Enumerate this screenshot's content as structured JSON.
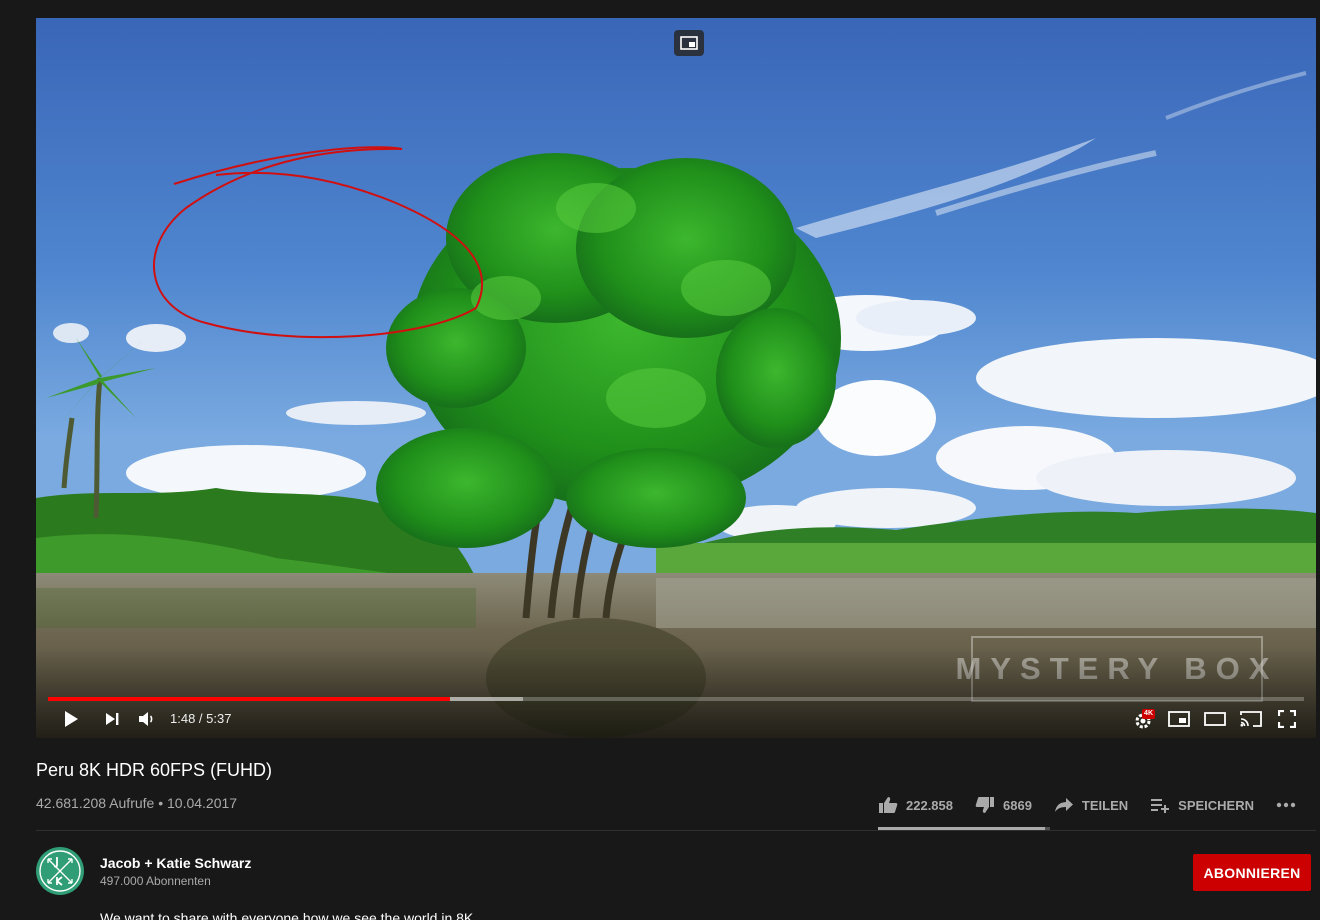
{
  "player": {
    "watermark": "MYSTERY BOX",
    "current_time": "1:48",
    "duration": "5:37",
    "time_display": "1:48 / 5:37",
    "progress_played_fraction": 0.32,
    "progress_buffered_fraction": 0.378,
    "quality_badge": "4K"
  },
  "video": {
    "title": "Peru 8K HDR 60FPS (FUHD)",
    "views": "42.681.208 Aufrufe",
    "date": "10.04.2017",
    "meta": "42.681.208 Aufrufe • 10.04.2017"
  },
  "actions": {
    "likes": "222.858",
    "dislikes": "6869",
    "share_label": "TEILEN",
    "save_label": "SPEICHERN",
    "like_fraction": 0.97
  },
  "channel": {
    "name": "Jacob + Katie Schwarz",
    "subscribers": "497.000 Abonnenten",
    "subscribe_label": "ABONNIEREN",
    "description": "We want to share with everyone how we see the world in 8K"
  },
  "colors": {
    "background": "#181818",
    "progress": "#ff0000",
    "subscribe": "#cc0000",
    "annotation": "#d01010"
  },
  "icons": [
    "miniplayer-icon",
    "play-icon",
    "next-icon",
    "volume-icon",
    "settings-icon",
    "miniplayer-icon",
    "theater-icon",
    "cast-icon",
    "fullscreen-icon",
    "thumb-up-icon",
    "thumb-down-icon",
    "share-icon",
    "save-icon",
    "more-icon"
  ]
}
